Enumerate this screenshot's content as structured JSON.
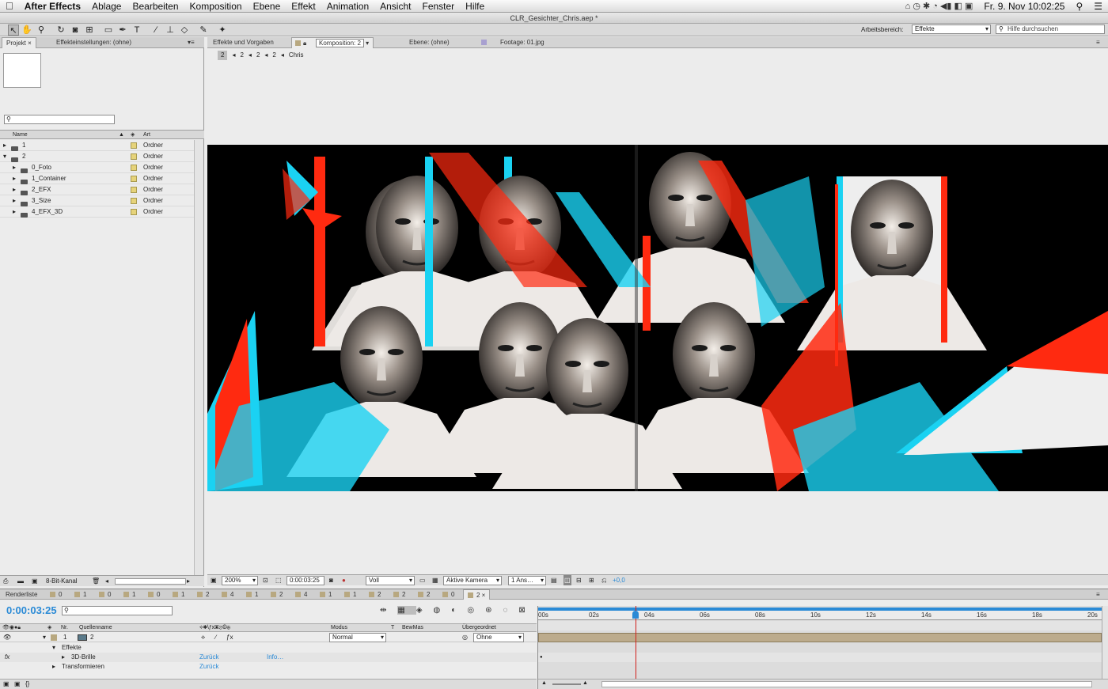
{
  "menubar": {
    "app": "After Effects",
    "items": [
      "Ablage",
      "Bearbeiten",
      "Komposition",
      "Ebene",
      "Effekt",
      "Animation",
      "Ansicht",
      "Fenster",
      "Hilfe"
    ],
    "clock": "Fr. 9. Nov  10:02:25"
  },
  "window_title": "CLR_Gesichter_Chris.aep *",
  "toolbar": {
    "workspace_label": "Arbeitsbereich:",
    "workspace_value": "Effekte",
    "help_placeholder": "Hilfe durchsuchen"
  },
  "project": {
    "tab_project": "Projekt",
    "tab_effects": "Effekteinstellungen: (ohne)",
    "col_name": "Name",
    "col_type": "Art",
    "rows": [
      {
        "name": "1",
        "type": "Ordner",
        "indent": 0,
        "open": false
      },
      {
        "name": "2",
        "type": "Ordner",
        "indent": 0,
        "open": true
      },
      {
        "name": "0_Foto",
        "type": "Ordner",
        "indent": 1,
        "open": false
      },
      {
        "name": "1_Container",
        "type": "Ordner",
        "indent": 1,
        "open": false
      },
      {
        "name": "2_EFX",
        "type": "Ordner",
        "indent": 1,
        "open": false
      },
      {
        "name": "3_Size",
        "type": "Ordner",
        "indent": 1,
        "open": false
      },
      {
        "name": "4_EFX_3D",
        "type": "Ordner",
        "indent": 1,
        "open": false
      }
    ],
    "bit_depth": "8-Bit-Kanal"
  },
  "viewer_tabs": {
    "effects_presets": "Effekte und Vorgaben",
    "composition": "Komposition: 2",
    "layer": "Ebene: (ohne)",
    "footage": "Footage: 01.jpg"
  },
  "breadcrumb": [
    "2",
    "2",
    "2",
    "2",
    "Chris"
  ],
  "viewer_footer": {
    "zoom": "200%",
    "time": "0:00:03:25",
    "resolution": "Voll",
    "camera": "Aktive Kamera",
    "views": "1 Ans…",
    "exposure": "+0,0"
  },
  "timeline_tabs": [
    "Renderliste",
    "0",
    "1",
    "0",
    "1",
    "0",
    "1",
    "2",
    "4",
    "1",
    "2",
    "4",
    "1",
    "1",
    "2",
    "2",
    "2",
    "0",
    "2"
  ],
  "timeline": {
    "current_time": "0:00:03:25",
    "col_nr": "Nr.",
    "col_source": "Quellenname",
    "col_mode": "Modus",
    "col_t": "T",
    "col_trkmat": "BewMas",
    "col_parent": "Übergeordnet",
    "ruler": [
      "00s",
      "02s",
      "04s",
      "06s",
      "08s",
      "10s",
      "12s",
      "14s",
      "16s",
      "18s",
      "20s"
    ],
    "playhead_seconds": 3.5,
    "layer": {
      "number": "1",
      "name": "2",
      "mode": "Normal",
      "parent": "Ohne"
    },
    "effects_label": "Effekte",
    "effect_name": "3D-Brille",
    "effect_reset": "Zurück",
    "effect_info": "Info…",
    "transform_label": "Transformieren",
    "transform_reset": "Zurück"
  },
  "colors": {
    "accent": "#2a8ad6",
    "anaglyph_red": "#ff2a10",
    "anaglyph_cyan": "#1ad2f2",
    "folder_label": "#e6d37a"
  }
}
